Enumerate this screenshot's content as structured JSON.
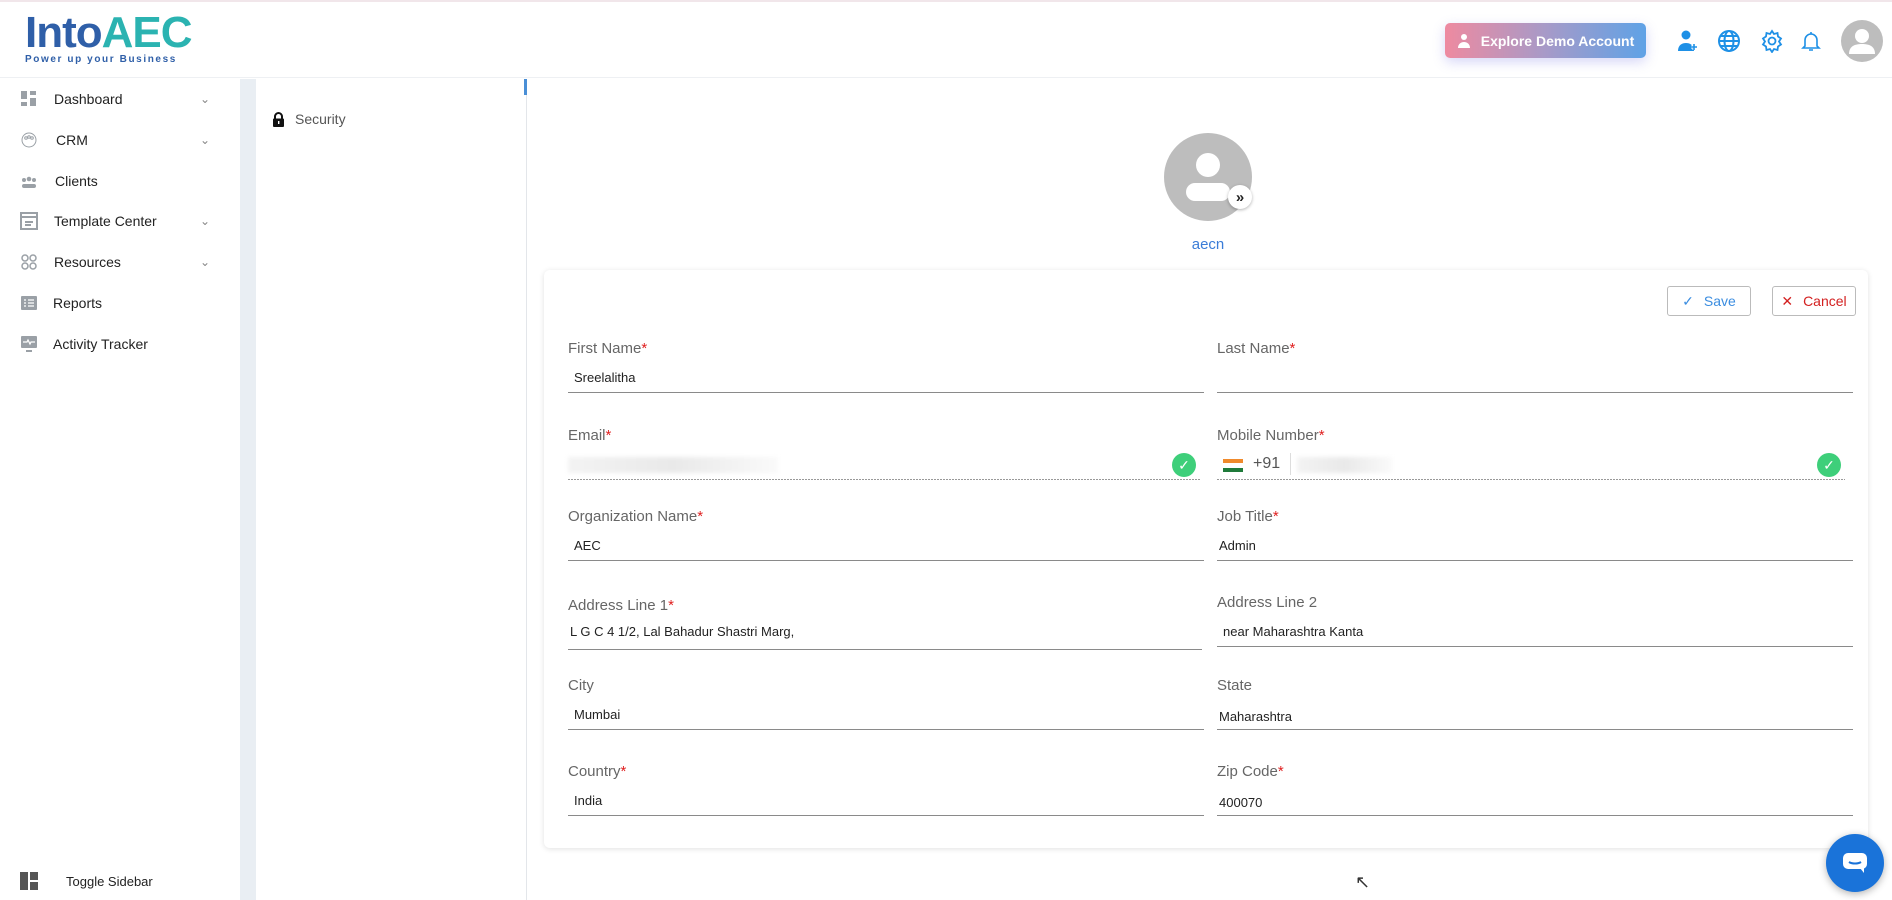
{
  "header": {
    "logo_main": "Into",
    "logo_accent": "AEC",
    "logo_tagline": "Power up your Business",
    "demo_button": "Explore Demo Account"
  },
  "sidebar": {
    "items": [
      {
        "label": "Dashboard",
        "icon": "dashboard-icon",
        "expandable": true
      },
      {
        "label": "CRM",
        "icon": "crm-icon",
        "expandable": true
      },
      {
        "label": "Clients",
        "icon": "clients-icon",
        "expandable": false
      },
      {
        "label": "Template Center",
        "icon": "template-icon",
        "expandable": true
      },
      {
        "label": "Resources",
        "icon": "resources-icon",
        "expandable": true
      },
      {
        "label": "Reports",
        "icon": "reports-icon",
        "expandable": false
      },
      {
        "label": "Activity Tracker",
        "icon": "activity-icon",
        "expandable": false
      }
    ],
    "toggle": "Toggle Sidebar"
  },
  "subnav": {
    "security": "Security"
  },
  "profile": {
    "username": "aecn",
    "save": "Save",
    "cancel": "Cancel"
  },
  "form": {
    "first_name": {
      "label": "First Name",
      "value": "Sreelalitha"
    },
    "last_name": {
      "label": "Last Name",
      "value": ""
    },
    "email": {
      "label": "Email",
      "value": ""
    },
    "mobile": {
      "label": "Mobile Number",
      "code": "+91",
      "value": ""
    },
    "org": {
      "label": "Organization Name",
      "value": "AEC"
    },
    "job": {
      "label": "Job Title",
      "value": "Admin"
    },
    "addr1": {
      "label": "Address Line 1",
      "value": "L G C 4 1/2, Lal Bahadur Shastri Marg,"
    },
    "addr2": {
      "label": "Address Line 2",
      "value": "near Maharashtra Kanta"
    },
    "city": {
      "label": "City",
      "value": "Mumbai"
    },
    "state": {
      "label": "State",
      "value": "Maharashtra"
    },
    "country": {
      "label": "Country",
      "value": "India"
    },
    "zip": {
      "label": "Zip Code",
      "value": "400070"
    },
    "required_mark": "*"
  },
  "colors": {
    "accent": "#1e90e6",
    "save": "#3b8de0",
    "cancel": "#d32020",
    "valid": "#3ecf7a"
  }
}
